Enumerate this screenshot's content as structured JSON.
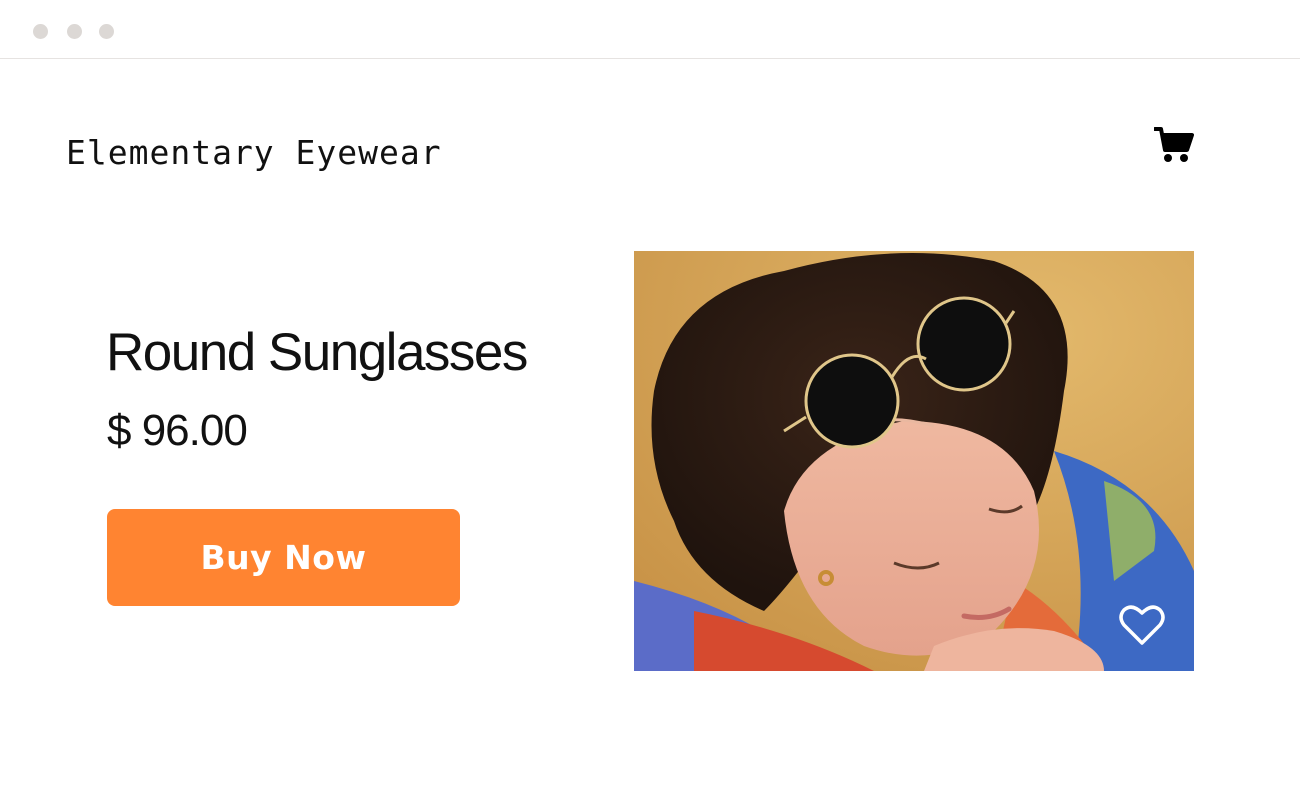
{
  "window": {
    "controls": [
      "window-dot",
      "window-dot",
      "window-dot"
    ]
  },
  "header": {
    "brand": "Elementary Eyewear",
    "cart_icon": "shopping-cart-icon"
  },
  "product": {
    "title": "Round Sunglasses",
    "price": "$ 96.00",
    "buy_label": "Buy Now",
    "image_alt_subject": "woman wearing round sunglasses on head",
    "favorite_icon": "heart-outline-icon"
  },
  "colors": {
    "accent": "#ff8431",
    "text": "#111111",
    "window_dot": "#dcd8d5"
  }
}
